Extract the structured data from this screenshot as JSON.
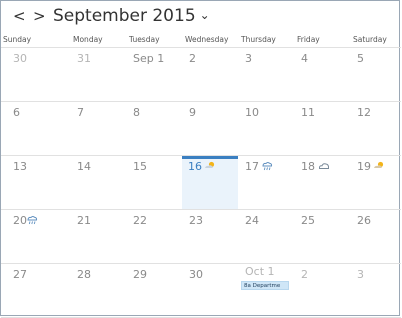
{
  "header": {
    "prev_icon": "<",
    "next_icon": ">",
    "month_title": "September 2015",
    "dropdown_icon": "⌄"
  },
  "weekdays": [
    "Sunday",
    "Monday",
    "Tuesday",
    "Wednesday",
    "Thursday",
    "Friday",
    "Saturday"
  ],
  "weeks": [
    [
      "30",
      "31",
      "Sep 1",
      "2",
      "3",
      "4",
      "5"
    ],
    [
      "6",
      "7",
      "8",
      "9",
      "10",
      "11",
      "12"
    ],
    [
      "13",
      "14",
      "15",
      "16",
      "17",
      "18",
      "19"
    ],
    [
      "20",
      "21",
      "22",
      "23",
      "24",
      "25",
      "26"
    ],
    [
      "27",
      "28",
      "29",
      "30",
      "Oct 1",
      "2",
      "3"
    ]
  ],
  "weather": {
    "sep16": "partly-sunny-icon",
    "sep17": "rain-icon",
    "sep18": "cloudy-icon",
    "sep19": "partly-sunny-icon",
    "sep20": "rain-icon"
  },
  "events": {
    "oct1": "8a Departme"
  },
  "colors": {
    "accent": "#3a7fc1",
    "selected_bg": "#eaf3fb",
    "event_bg": "#cfe6f7"
  }
}
